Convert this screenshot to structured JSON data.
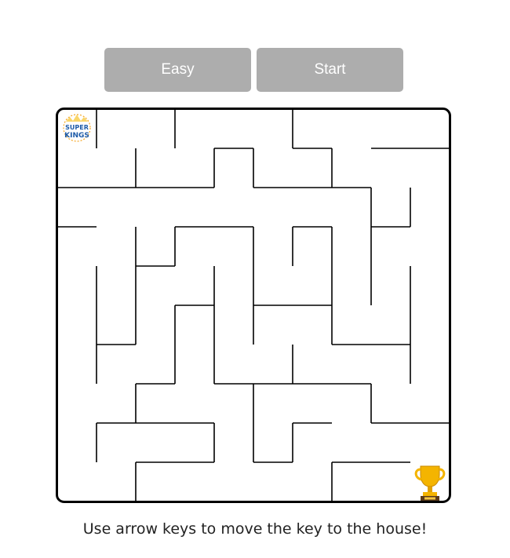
{
  "controls": {
    "difficulty_label": "Easy",
    "start_label": "Start"
  },
  "maze": {
    "rows": 10,
    "cols": 10,
    "wall_color": "#000000",
    "segments": [
      [
        1,
        0,
        1,
        1
      ],
      [
        3,
        0,
        3,
        1
      ],
      [
        6,
        0,
        6,
        1
      ],
      [
        2,
        1,
        2,
        2
      ],
      [
        4,
        1,
        5,
        1
      ],
      [
        4,
        1,
        4,
        2
      ],
      [
        5,
        1,
        5,
        2
      ],
      [
        6,
        1,
        7,
        1
      ],
      [
        7,
        1,
        7,
        2
      ],
      [
        8,
        1,
        10,
        1
      ],
      [
        0,
        2,
        4,
        2
      ],
      [
        5,
        2,
        7,
        2
      ],
      [
        7,
        2,
        8,
        2
      ],
      [
        8,
        2,
        8,
        3
      ],
      [
        9,
        2,
        9,
        3
      ],
      [
        0,
        3,
        1,
        3
      ],
      [
        2,
        3,
        2,
        4
      ],
      [
        3,
        3,
        5,
        3
      ],
      [
        3,
        3,
        3,
        4
      ],
      [
        5,
        3,
        5,
        6
      ],
      [
        6,
        3,
        7,
        3
      ],
      [
        6,
        3,
        6,
        4
      ],
      [
        7,
        3,
        7,
        5
      ],
      [
        8,
        3,
        9,
        3
      ],
      [
        8,
        3,
        8,
        5
      ],
      [
        1,
        4,
        1,
        7
      ],
      [
        2,
        4,
        3,
        4
      ],
      [
        4,
        4,
        4,
        7
      ],
      [
        9,
        4,
        9,
        7
      ],
      [
        3,
        5,
        4,
        5
      ],
      [
        3,
        5,
        3,
        7
      ],
      [
        5,
        5,
        7,
        5
      ],
      [
        1,
        6,
        2,
        6
      ],
      [
        2,
        4,
        2,
        6
      ],
      [
        7,
        5,
        7,
        6
      ],
      [
        7,
        6,
        9,
        6
      ],
      [
        6,
        6,
        6,
        7
      ],
      [
        2,
        7,
        3,
        7
      ],
      [
        2,
        7,
        2,
        8
      ],
      [
        4,
        7,
        8,
        7
      ],
      [
        5,
        7,
        5,
        9
      ],
      [
        8,
        7,
        8,
        8
      ],
      [
        1,
        8,
        4,
        8
      ],
      [
        1,
        8,
        1,
        9
      ],
      [
        4,
        8,
        4,
        9
      ],
      [
        6,
        8,
        7,
        8
      ],
      [
        6,
        8,
        6,
        9
      ],
      [
        8,
        8,
        10,
        8
      ],
      [
        2,
        9,
        4,
        9
      ],
      [
        2,
        9,
        2,
        10
      ],
      [
        5,
        9,
        6,
        9
      ],
      [
        7,
        9,
        9,
        9
      ],
      [
        7,
        9,
        7,
        10
      ]
    ]
  },
  "player": {
    "icon": "super-kings-logo-icon",
    "label": "SUPER KINGS"
  },
  "goal": {
    "icon": "trophy-icon"
  },
  "instructions": "Use arrow keys to move the key to the house!"
}
